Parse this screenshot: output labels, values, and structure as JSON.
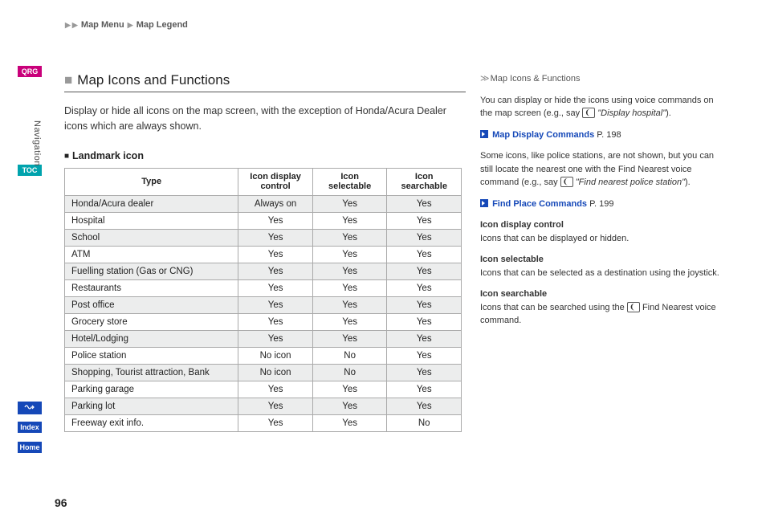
{
  "breadcrumb": {
    "a": "Map Menu",
    "b": "Map Legend"
  },
  "tabs": {
    "qrg": "QRG",
    "toc": "TOC",
    "index": "Index",
    "home": "Home"
  },
  "section_vert": "Navigation",
  "title": "Map Icons and Functions",
  "intro": "Display or hide all icons on the map screen, with the exception of Honda/Acura Dealer icons which are always shown.",
  "subhead": "Landmark icon",
  "table": {
    "headers": {
      "type": "Type",
      "display": "Icon display control",
      "selectable": "Icon selectable",
      "searchable": "Icon searchable"
    },
    "rows": [
      {
        "type": "Honda/Acura dealer",
        "display": "Always on",
        "selectable": "Yes",
        "searchable": "Yes"
      },
      {
        "type": "Hospital",
        "display": "Yes",
        "selectable": "Yes",
        "searchable": "Yes"
      },
      {
        "type": "School",
        "display": "Yes",
        "selectable": "Yes",
        "searchable": "Yes"
      },
      {
        "type": "ATM",
        "display": "Yes",
        "selectable": "Yes",
        "searchable": "Yes"
      },
      {
        "type": "Fuelling station (Gas or CNG)",
        "display": "Yes",
        "selectable": "Yes",
        "searchable": "Yes"
      },
      {
        "type": "Restaurants",
        "display": "Yes",
        "selectable": "Yes",
        "searchable": "Yes"
      },
      {
        "type": "Post office",
        "display": "Yes",
        "selectable": "Yes",
        "searchable": "Yes"
      },
      {
        "type": "Grocery store",
        "display": "Yes",
        "selectable": "Yes",
        "searchable": "Yes"
      },
      {
        "type": "Hotel/Lodging",
        "display": "Yes",
        "selectable": "Yes",
        "searchable": "Yes"
      },
      {
        "type": "Police station",
        "display": "No icon",
        "selectable": "No",
        "searchable": "Yes"
      },
      {
        "type": "Shopping, Tourist attraction, Bank",
        "display": "No icon",
        "selectable": "No",
        "searchable": "Yes"
      },
      {
        "type": "Parking garage",
        "display": "Yes",
        "selectable": "Yes",
        "searchable": "Yes"
      },
      {
        "type": "Parking lot",
        "display": "Yes",
        "selectable": "Yes",
        "searchable": "Yes"
      },
      {
        "type": "Freeway exit info.",
        "display": "Yes",
        "selectable": "Yes",
        "searchable": "No"
      }
    ]
  },
  "aside": {
    "title": "Map Icons & Functions",
    "p1a": "You can display or hide the icons using voice commands on the map screen (e.g., say ",
    "p1b": "\"Display hospital\"",
    "p1c": ").",
    "link1": "Map Display Commands",
    "link1_page": "P. 198",
    "p2a": "Some icons, like police stations, are not shown, but you can still locate the nearest one with the Find Nearest voice command (e.g., say ",
    "p2b": "\"Find nearest police station\"",
    "p2c": ").",
    "link2": "Find Place Commands",
    "link2_page": "P. 199",
    "term1": "Icon display control",
    "term1_desc": "Icons that can be displayed or hidden.",
    "term2": "Icon selectable",
    "term2_desc": "Icons that can be selected as a destination using the joystick.",
    "term3": "Icon searchable",
    "term3_desc_a": "Icons that can be searched using the ",
    "term3_desc_b": " Find Nearest voice command."
  },
  "pagenum": "96"
}
